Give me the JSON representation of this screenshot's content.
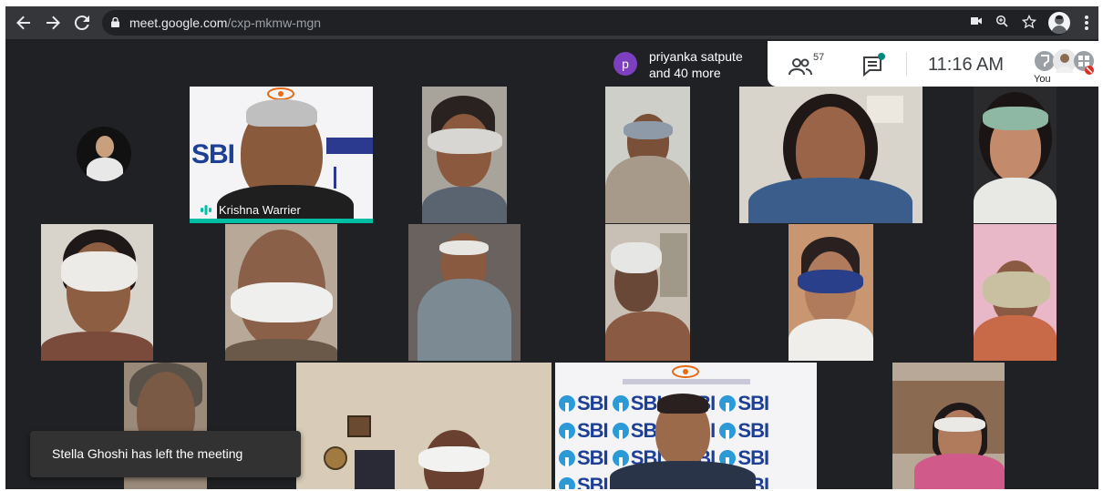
{
  "browser": {
    "url_host": "meet.google.com",
    "url_path": "/cxp-mkmw-mgn",
    "back_icon": "arrow-left-icon",
    "forward_icon": "arrow-right-icon",
    "reload_icon": "reload-icon"
  },
  "meet": {
    "presenter": {
      "initial": "p",
      "name": "priyanka satpute",
      "more": "and 40 more"
    },
    "people_count": "57",
    "time": "11:16 AM",
    "self_label": "You",
    "speaker_name": "Krishna Warrier",
    "toast": "Stella Ghoshi has left the meeting",
    "colors": {
      "accent": "#00bfa5",
      "toast_bg": "#323232",
      "presenter_avatar": "#7b3fbf",
      "sbi_blue": "#1d3f95"
    }
  }
}
